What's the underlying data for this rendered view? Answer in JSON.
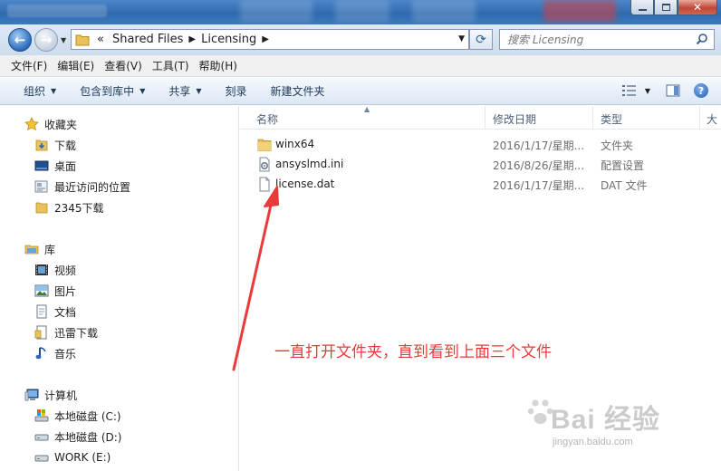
{
  "window": {
    "accent": "#2f6aae"
  },
  "address": {
    "prefix": "«",
    "crumbs": [
      "Shared Files",
      "Licensing"
    ],
    "search_placeholder": "搜索 Licensing"
  },
  "menu": [
    "文件(F)",
    "编辑(E)",
    "查看(V)",
    "工具(T)",
    "帮助(H)"
  ],
  "commands": {
    "organize": "组织",
    "include_library": "包含到库中",
    "share": "共享",
    "burn": "刻录",
    "new_folder": "新建文件夹"
  },
  "nav": {
    "favorites": "收藏夹",
    "favorites_items": [
      "下载",
      "桌面",
      "最近访问的位置",
      "2345下载"
    ],
    "libraries": "库",
    "libraries_items": [
      "视频",
      "图片",
      "文档",
      "迅雷下载",
      "音乐"
    ],
    "computer": "计算机",
    "drives": [
      "本地磁盘 (C:)",
      "本地磁盘 (D:)",
      "WORK (E:)"
    ]
  },
  "columns": {
    "name": "名称",
    "date": "修改日期",
    "type": "类型",
    "size": "大"
  },
  "files": [
    {
      "name": "winx64",
      "date": "2016/1/17/星期...",
      "type": "文件夹",
      "icon": "folder-icon"
    },
    {
      "name": "ansyslmd.ini",
      "date": "2016/8/26/星期...",
      "type": "配置设置",
      "icon": "config-file-icon"
    },
    {
      "name": "license.dat",
      "date": "2016/1/17/星期...",
      "type": "DAT 文件",
      "icon": "file-icon"
    }
  ],
  "annotation": {
    "text": "一直打开文件夹，直到看到上面三个文件",
    "color": "#e63a3a"
  },
  "watermark": {
    "brand": "Bai 经验",
    "url": "jingyan.baidu.com"
  }
}
